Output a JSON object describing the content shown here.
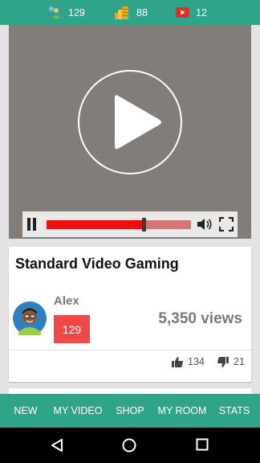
{
  "top_stats": {
    "followers": "129",
    "coins": "88",
    "videos": "12"
  },
  "player": {
    "progress": 0.67
  },
  "video": {
    "title": "Standard Video Gaming",
    "author": "Alex",
    "author_level": "129",
    "views": "5,350 views",
    "likes": "134",
    "dislikes": "21"
  },
  "bottom_nav": {
    "new": "NEW",
    "my_video": "MY VIDEO",
    "shop": "SHOP",
    "my_room": "MY ROOM",
    "stats": "STATS"
  },
  "colors": {
    "accent": "#2fa488",
    "seek_fill": "#ea0e0e",
    "badge": "#ef4848"
  },
  "icons": [
    "people-icon",
    "coins-icon",
    "youtube-icon",
    "play-icon",
    "pause-icon",
    "volume-icon",
    "fullscreen-icon",
    "thumbs-up-icon",
    "thumbs-down-icon",
    "back-icon",
    "home-icon",
    "recents-icon"
  ]
}
